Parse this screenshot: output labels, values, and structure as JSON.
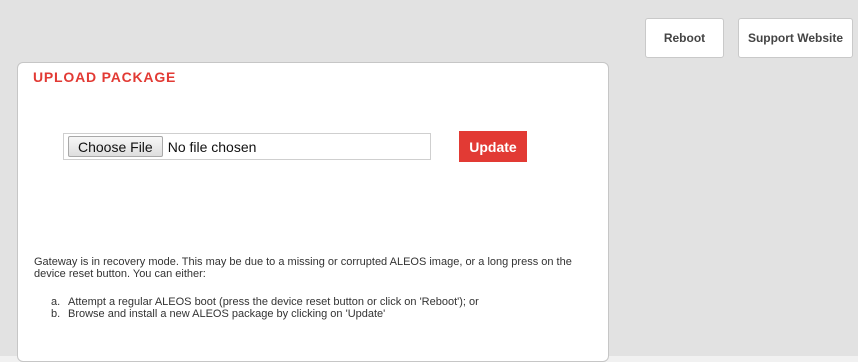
{
  "header": {
    "reboot_label": "Reboot",
    "support_label": "Support Website"
  },
  "upload_panel": {
    "title": "UPLOAD PACKAGE",
    "choose_file_label": "Choose File",
    "file_status": "No file chosen",
    "update_label": "Update",
    "message": "Gateway is in recovery mode. This may be due to a missing or corrupted ALEOS image, or a long press on the device reset button. You can either:",
    "options": [
      {
        "marker": "a.",
        "text": "Attempt a regular ALEOS boot (press the device reset button or click on 'Reboot'); or"
      },
      {
        "marker": "b.",
        "text": "Browse and install a new ALEOS package by clicking on 'Update'"
      }
    ]
  },
  "colors": {
    "accent": "#e23a34",
    "background": "#e2e2e2"
  }
}
